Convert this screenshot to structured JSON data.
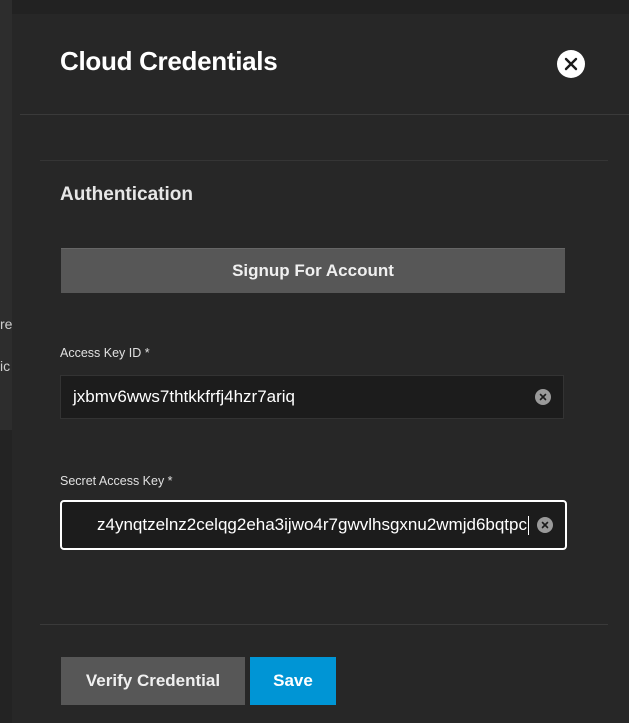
{
  "dialog": {
    "title": "Cloud Credentials",
    "close_icon": "close-icon"
  },
  "background": {
    "text_1": "re",
    "text_2": "ic"
  },
  "authentication": {
    "section_title": "Authentication",
    "signup_label": "Signup For Account",
    "access_key_id": {
      "label": "Access Key ID *",
      "value": "jxbmv6wws7thtkkfrfj4hzr7ariq"
    },
    "secret_access_key": {
      "label": "Secret Access Key *",
      "value": "z4ynqtzelnz2celqg2eha3ijwo4r7gwvlhsgxnu2wmjd6bqtpc"
    }
  },
  "actions": {
    "verify_label": "Verify Credential",
    "save_label": "Save"
  },
  "colors": {
    "panel_bg": "#272727",
    "button_gray": "#575757",
    "accent_blue": "#0095d5"
  }
}
